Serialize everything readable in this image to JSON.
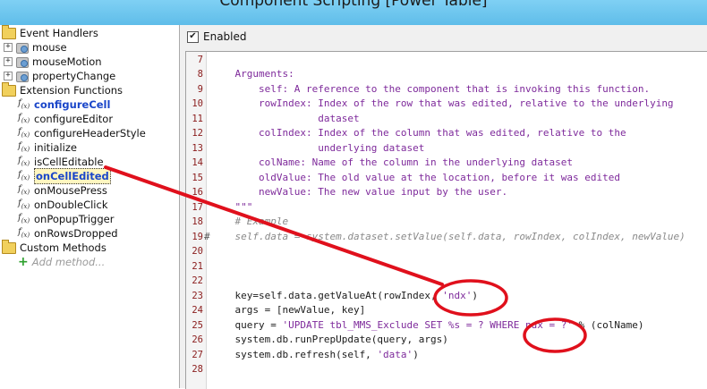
{
  "window": {
    "title": "Component Scripting [Power Table]"
  },
  "tree": {
    "event_handlers": "Event Handlers",
    "events": [
      "mouse",
      "mouseMotion",
      "propertyChange"
    ],
    "extension_functions": "Extension Functions",
    "functions": [
      "configureCell",
      "configureEditor",
      "configureHeaderStyle",
      "initialize",
      "isCellEditable",
      "onCellEdited",
      "onMousePress",
      "onDoubleClick",
      "onPopupTrigger",
      "onRowsDropped"
    ],
    "selected_function": "onCellEdited",
    "custom_methods": "Custom Methods",
    "add_method": "Add method..."
  },
  "editor": {
    "enabled_label": "Enabled",
    "enabled_checked": true,
    "lines": [
      {
        "n": "7",
        "text": ""
      },
      {
        "n": "8",
        "text": "    Arguments:"
      },
      {
        "n": "9",
        "text": "        self: A reference to the component that is invoking this function."
      },
      {
        "n": "10",
        "text": "        rowIndex: Index of the row that was edited, relative to the underlying"
      },
      {
        "n": "11",
        "text": "                  dataset"
      },
      {
        "n": "12",
        "text": "        colIndex: Index of the column that was edited, relative to the"
      },
      {
        "n": "13",
        "text": "                  underlying dataset"
      },
      {
        "n": "14",
        "text": "        colName: Name of the column in the underlying dataset"
      },
      {
        "n": "15",
        "text": "        oldValue: The old value at the location, before it was edited"
      },
      {
        "n": "16",
        "text": "        newValue: The new value input by the user."
      },
      {
        "n": "17",
        "text": "    \"\"\""
      },
      {
        "n": "18",
        "text": "    # Example"
      },
      {
        "n": "19",
        "text": "    self.data = system.dataset.setValue(self.data, rowIndex, colIndex, newValue)"
      },
      {
        "n": "20",
        "text": ""
      },
      {
        "n": "21",
        "text": ""
      },
      {
        "n": "22",
        "text": ""
      },
      {
        "n": "23",
        "text": "    key=self.data.getValueAt(rowIndex, 'ndx')"
      },
      {
        "n": "24",
        "text": "    args = [newValue, key]"
      },
      {
        "n": "25",
        "text": "    query = 'UPDATE tbl_MMS_Exclude SET %s = ? WHERE ndx = ?' % (colName)"
      },
      {
        "n": "26",
        "text": "    system.db.runPrepUpdate(query, args)"
      },
      {
        "n": "27",
        "text": "    system.db.refresh(self, 'data')"
      },
      {
        "n": "28",
        "text": ""
      }
    ],
    "comment_marker": "#"
  },
  "colors": {
    "title_bar": "#6cc6ee",
    "docstring": "#7e2a9b",
    "comment": "#8a8a8a",
    "line_number": "#8a1c1c",
    "annotation": "#e0101c",
    "function_bold": "#1a46c9"
  }
}
